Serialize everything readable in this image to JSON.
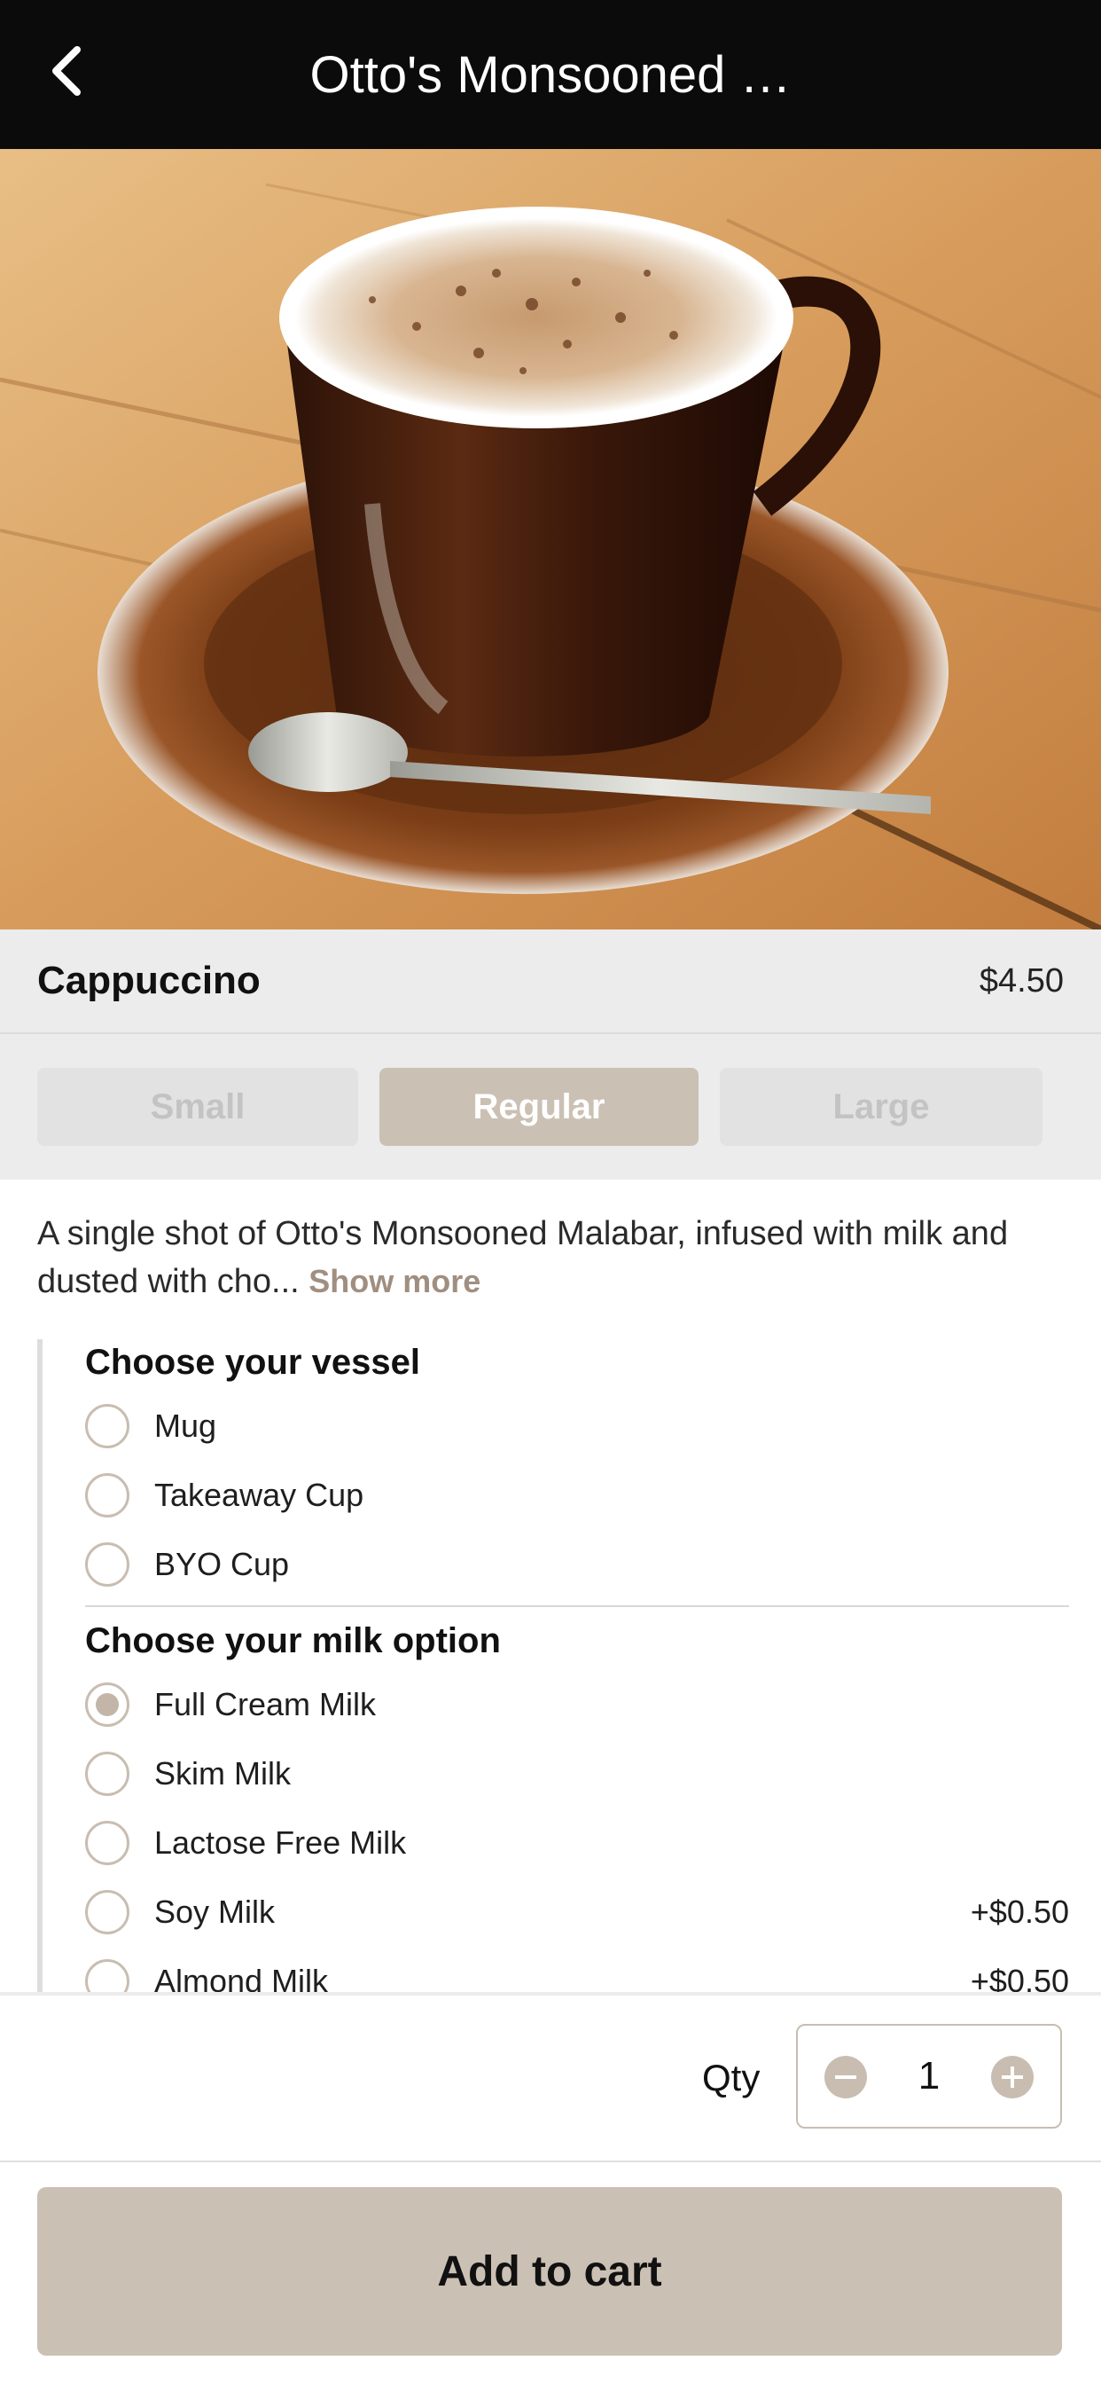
{
  "header": {
    "title": "Otto's Monsooned …"
  },
  "product": {
    "name": "Cappuccino",
    "price": "$4.50",
    "sizes": [
      {
        "label": "Small",
        "selected": false
      },
      {
        "label": "Regular",
        "selected": true
      },
      {
        "label": "Large",
        "selected": false
      }
    ],
    "description": "A single shot of Otto's Monsooned Malabar, infused with milk and dusted with cho...",
    "show_more_label": "Show more"
  },
  "options": {
    "vessel": {
      "title": "Choose your vessel",
      "items": [
        {
          "label": "Mug",
          "checked": false
        },
        {
          "label": "Takeaway Cup",
          "checked": false
        },
        {
          "label": "BYO Cup",
          "checked": false
        }
      ]
    },
    "milk": {
      "title": "Choose your milk option",
      "items": [
        {
          "label": "Full Cream Milk",
          "checked": true,
          "price": ""
        },
        {
          "label": "Skim Milk",
          "checked": false,
          "price": ""
        },
        {
          "label": "Lactose Free Milk",
          "checked": false,
          "price": ""
        },
        {
          "label": "Soy Milk",
          "checked": false,
          "price": "+$0.50"
        },
        {
          "label": "Almond Milk",
          "checked": false,
          "price": "+$0.50"
        }
      ]
    }
  },
  "quantity": {
    "label": "Qty",
    "value": "1"
  },
  "cart": {
    "add_label": "Add to cart"
  },
  "colors": {
    "header_bg": "#0b0b0b",
    "accent": "#cbc0b4",
    "panel_bg": "#ececec",
    "link": "#a08f80"
  },
  "icons": {
    "back": "chevron-left-icon",
    "minus": "minus-circle-icon",
    "plus": "plus-circle-icon"
  }
}
